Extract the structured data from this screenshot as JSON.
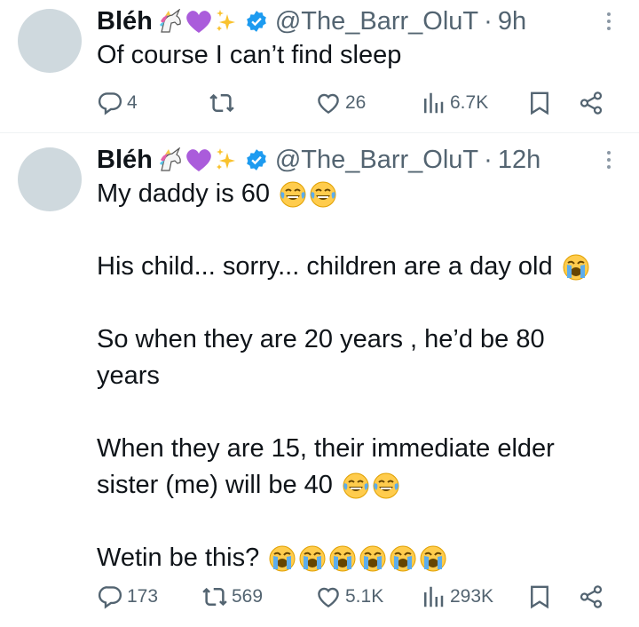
{
  "tweets": [
    {
      "display_name": "Bléh",
      "handle": "@The_Barr_OluT",
      "dot": "·",
      "time": "9h",
      "lines": [
        "Of course I can’t find sleep"
      ],
      "replies": "4",
      "retweets": "",
      "likes": "26",
      "views": "6.7K"
    },
    {
      "display_name": "Bléh",
      "handle": "@The_Barr_OluT",
      "dot": "·",
      "time": "12h",
      "lines": [
        "My daddy is 60",
        "His child... sorry... children are a day old",
        "So when they are 20 years , he’d be 80",
        "years",
        "When they are 15, their immediate elder",
        "sister (me) will be 40",
        "Wetin be this?"
      ],
      "replies": "173",
      "retweets": "569",
      "likes": "5.1K",
      "views": "293K"
    }
  ],
  "icons": {
    "name_emojis": [
      "unicorn-icon",
      "purple-heart-icon",
      "sparkles-icon"
    ],
    "verified": "verified-badge-icon",
    "more": "more-options-icon",
    "reply": "reply-icon",
    "retweet": "retweet-icon",
    "like": "like-icon",
    "views": "views-icon",
    "bookmark": "bookmark-icon",
    "share": "share-icon",
    "laughing_crying": "face-with-tears-of-joy-icon",
    "crying": "loudly-crying-face-icon"
  },
  "colors": {
    "text": "#0f1419",
    "secondary": "#536471",
    "verified": "#1d9bf0",
    "avatar": "#cfd9de",
    "divider": "#eff3f4"
  }
}
